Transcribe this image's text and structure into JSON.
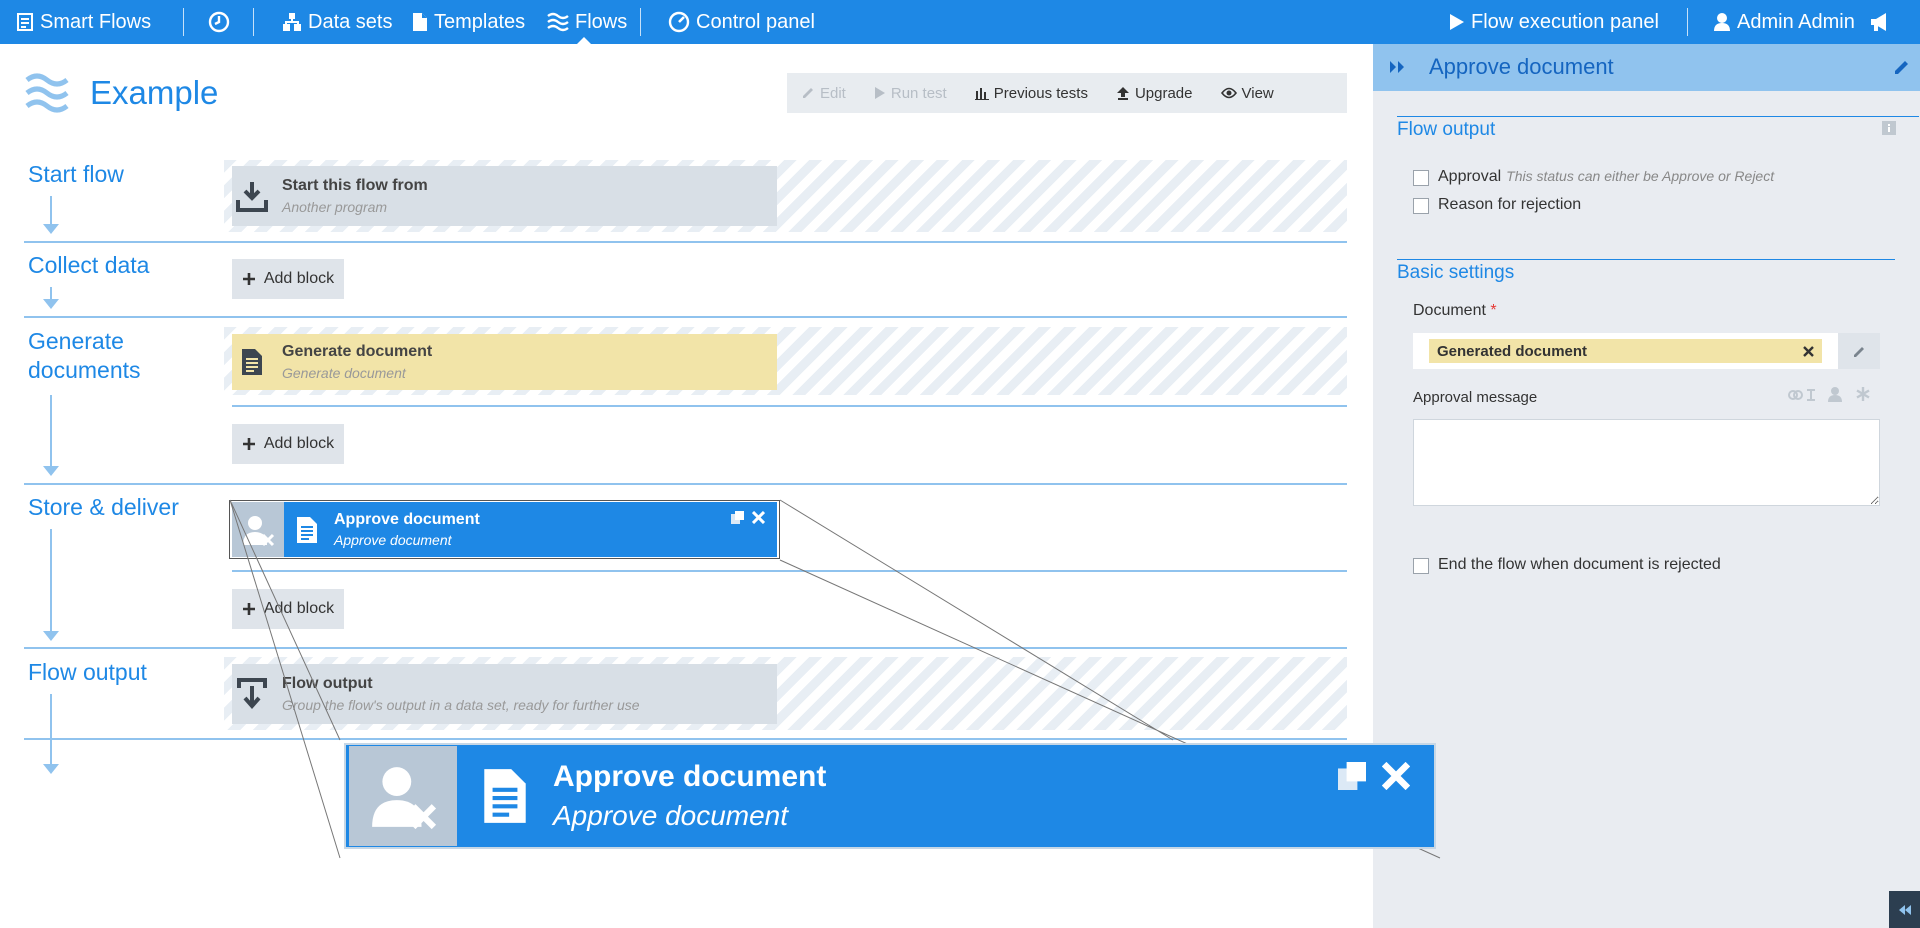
{
  "nav": {
    "brand": "Smart Flows",
    "datasets": "Data sets",
    "templates": "Templates",
    "flows": "Flows",
    "control_panel": "Control panel",
    "flow_execution_panel": "Flow execution panel",
    "user": "Admin Admin"
  },
  "flow": {
    "title": "Example",
    "toolbar": {
      "edit": "Edit",
      "run_test": "Run test",
      "previous_tests": "Previous tests",
      "upgrade": "Upgrade",
      "view": "View"
    },
    "stages": [
      {
        "label": "Start flow"
      },
      {
        "label": "Collect data"
      },
      {
        "label": "Generate documents"
      },
      {
        "label": "Store & deliver"
      },
      {
        "label": "Flow output"
      }
    ],
    "blocks": {
      "start": {
        "title": "Start this flow from",
        "subtitle": "Another program"
      },
      "generate": {
        "title": "Generate document",
        "subtitle": "Generate document"
      },
      "approve": {
        "title": "Approve document",
        "subtitle": "Approve document"
      },
      "output": {
        "title": "Flow output",
        "subtitle": "Group the flow's output in a data set, ready for further use"
      }
    },
    "add_block": "Add block"
  },
  "zoom": {
    "title": "Approve document",
    "subtitle": "Approve document"
  },
  "panel": {
    "title": "Approve document",
    "flow_output": {
      "heading": "Flow output",
      "items": [
        {
          "label": "Approval",
          "hint": "This status can either be Approve or Reject",
          "checked": false
        },
        {
          "label": "Reason for rejection",
          "checked": false
        }
      ]
    },
    "basic_settings": {
      "heading": "Basic settings",
      "document_label": "Document",
      "required_mark": "*",
      "document_value": "Generated document",
      "approval_message_label": "Approval message",
      "approval_message_value": "",
      "end_flow_label": "End the flow when document is rejected",
      "end_flow_checked": false
    }
  },
  "colors": {
    "accent": "#1e88e5",
    "panel_header": "#90c3ee",
    "panel_bg": "#e9ecf1",
    "generate_block": "#f2e4a8",
    "block_grey": "#d8dfe6"
  },
  "icons": [
    "list-icon",
    "clock-icon",
    "sitemap-icon",
    "file-icon",
    "waves-icon",
    "gauge-icon",
    "play-icon",
    "user-icon",
    "megaphone-icon",
    "pencil-icon",
    "bar-chart-icon",
    "upload-icon",
    "eye-icon",
    "download-icon",
    "document-icon",
    "plus-icon",
    "user-reject-icon",
    "copy-icon",
    "close-icon",
    "double-chevron-icon",
    "info-icon",
    "link-icon",
    "asterisk-icon"
  ]
}
